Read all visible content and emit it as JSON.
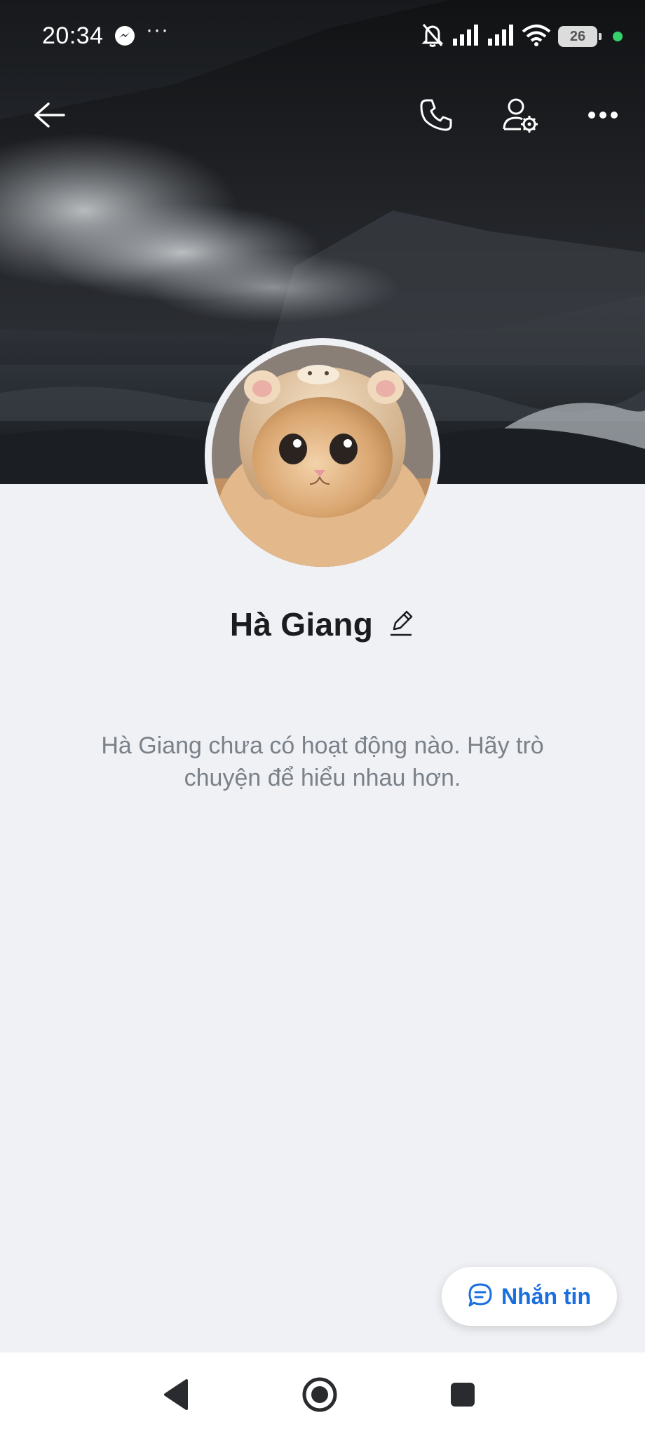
{
  "status_bar": {
    "time": "20:34",
    "more_indicator": "···",
    "battery_level": "26",
    "icons": [
      "messenger-icon",
      "bell-off-icon",
      "signal-icon",
      "signal-icon",
      "wifi-icon",
      "battery-icon"
    ]
  },
  "top_bar": {
    "icons": [
      "back-arrow-icon",
      "phone-icon",
      "user-settings-icon",
      "more-dots-icon"
    ]
  },
  "profile": {
    "name": "Hà Giang",
    "empty_activity": "Hà Giang chưa có hoạt động nào. Hãy trò chuyện để hiểu nhau hơn."
  },
  "message_button": {
    "label": "Nhắn tin",
    "color": "#1a6fe0"
  },
  "nav_bar": {
    "icons": [
      "back-triangle-icon",
      "home-circle-icon",
      "recents-square-icon"
    ]
  }
}
